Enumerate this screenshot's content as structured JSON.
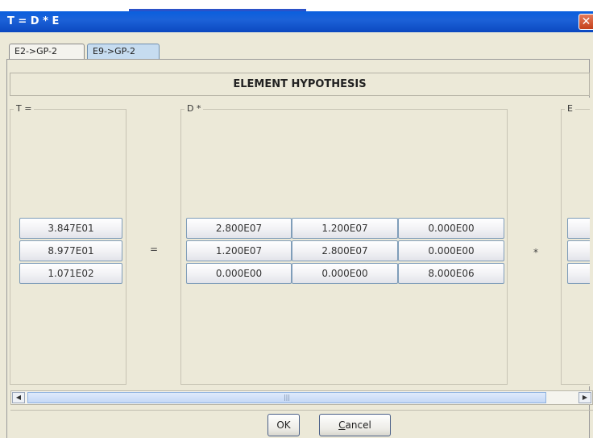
{
  "window": {
    "title": "T = D * E",
    "close_glyph": "✕"
  },
  "tabs": [
    {
      "label": "E2->GP-2",
      "selected": false
    },
    {
      "label": "E9->GP-2",
      "selected": true
    }
  ],
  "header": {
    "title": "ELEMENT HYPOTHESIS"
  },
  "groups": {
    "t_label": "T =",
    "d_label": "D *",
    "e_label": "E"
  },
  "operators": {
    "equals": "=",
    "times": "*"
  },
  "matrix_t": [
    "3.847E01",
    "8.977E01",
    "1.071E02"
  ],
  "matrix_d": [
    [
      "2.800E07",
      "1.200E07",
      "0.000E00"
    ],
    [
      "1.200E07",
      "2.800E07",
      "0.000E00"
    ],
    [
      "0.000E00",
      "0.000E00",
      "8.000E06"
    ]
  ],
  "scrollbar": {
    "left_arrow": "◀",
    "right_arrow": "▶",
    "grip": "|||"
  },
  "buttons": {
    "ok": "OK",
    "cancel_mnemonic": "C",
    "cancel_rest": "ancel"
  },
  "colors": {
    "title_bar": "#0a5fde",
    "close_button": "#c4401a",
    "selected_tab": "#c6dcf0",
    "dialog_bg": "#ece9d8"
  },
  "icons": [
    "close-icon",
    "scroll-left-icon",
    "scroll-right-icon"
  ]
}
